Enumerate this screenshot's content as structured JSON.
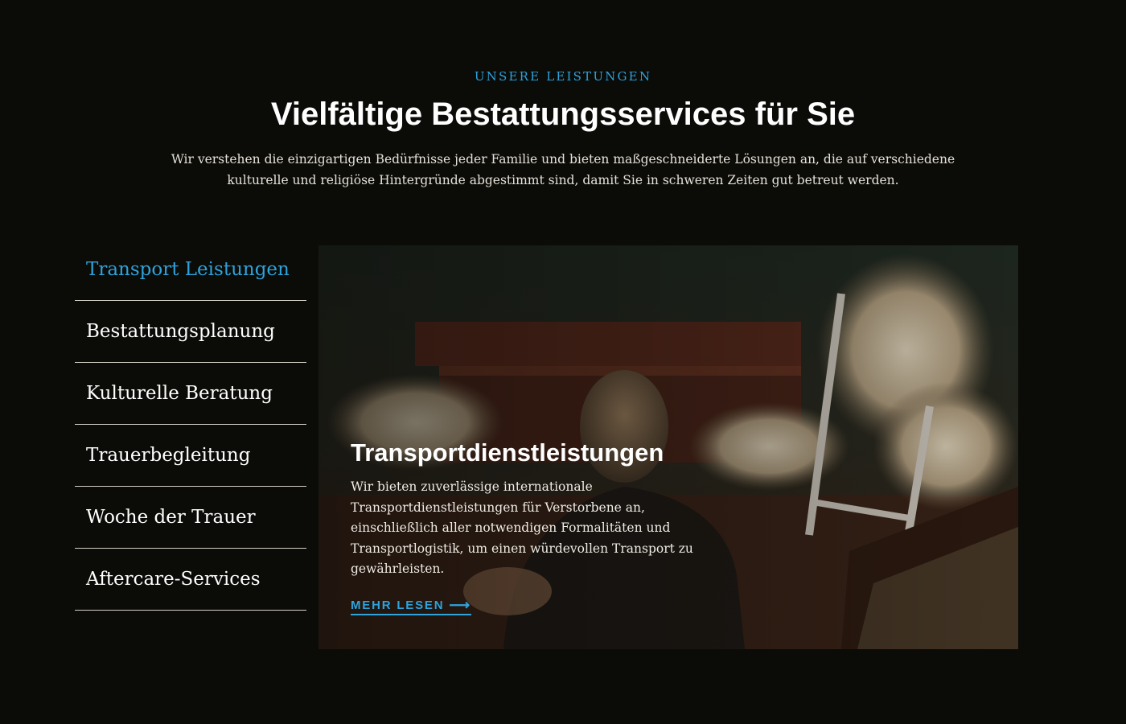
{
  "section": {
    "eyebrow": "UNSERE LEISTUNGEN",
    "headline": "Vielfältige Bestattungsservices für Sie",
    "intro": "Wir verstehen die einzigartigen Bedürfnisse jeder Familie und bieten maßgeschneiderte Lösungen an, die auf verschiedene kulturelle und religiöse Hintergründe abgestimmt sind, damit Sie in schweren Zeiten gut betreut werden."
  },
  "tabs": [
    {
      "label": "Transport Leistungen",
      "active": true
    },
    {
      "label": "Bestattungsplanung",
      "active": false
    },
    {
      "label": "Kulturelle Beratung",
      "active": false
    },
    {
      "label": "Trauerbegleitung",
      "active": false
    },
    {
      "label": "Woche der Trauer",
      "active": false
    },
    {
      "label": "Aftercare-Services",
      "active": false
    }
  ],
  "panel": {
    "title": "Transportdienstleistungen",
    "body": "Wir bieten zuverlässige internationale Transportdienstleistungen für Verstorbene an, einschließlich aller notwendigen Formalitäten und Transportlogistik, um einen würdevollen Transport zu gewährleisten.",
    "cta_label": "MEHR LESEN",
    "cta_icon": "arrow-right-icon"
  },
  "colors": {
    "background": "#0b0b08",
    "accent": "#2ea3dc",
    "text": "#ffffff"
  }
}
